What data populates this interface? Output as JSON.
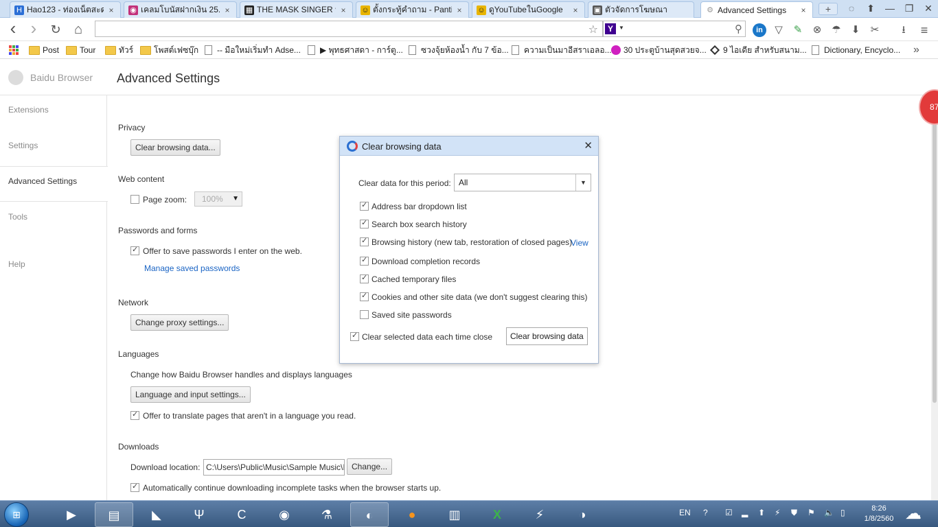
{
  "tabs": [
    {
      "title": "Hao123 - ท่องเน็ตสะด",
      "favicon_color": "#2c6fd6",
      "favicon_text": "H"
    },
    {
      "title": "เคลมโบนัสฝากเงิน 25.",
      "favicon_color": "#c2317a",
      "favicon_text": "◉"
    },
    {
      "title": "THE MASK SINGER ห",
      "favicon_color": "#222222",
      "favicon_text": "▦"
    },
    {
      "title": "ตั้งกระทู้คำถาม - Pantip",
      "favicon_color": "#e8b400",
      "favicon_text": "☺"
    },
    {
      "title": "ดูYouTubeในGoogle",
      "favicon_color": "#e8b400",
      "favicon_text": "☺"
    },
    {
      "title": "ตัวจัดการโฆษณา",
      "favicon_color": "#555555",
      "favicon_text": "▣"
    },
    {
      "title": "Advanced Settings",
      "favicon_color": "#bbbbbb",
      "favicon_text": "⚙"
    }
  ],
  "tab_close": "×",
  "window": {
    "minimize": "—",
    "maximize": "❐",
    "close": "✕",
    "newtab": "+"
  },
  "toolbar": {
    "back": "‹",
    "forward": "›",
    "reload": "↻",
    "home": "⌂",
    "url": "",
    "star": "☆",
    "search_engine": "Y",
    "search_caret": "▼",
    "search_icon": "⚲"
  },
  "toolbar_icons": [
    "in",
    "▽",
    "✎",
    "⊗",
    "☂",
    "⬇",
    "✂",
    "⭳",
    "≡"
  ],
  "bookmarks": [
    {
      "label": "",
      "type": "apps"
    },
    {
      "label": "Post",
      "type": "folder"
    },
    {
      "label": "Tour",
      "type": "folder"
    },
    {
      "label": "ทัวร์",
      "type": "folder"
    },
    {
      "label": "โพสต์เฟซบุ๊ก",
      "type": "folder"
    },
    {
      "label": "-- มือใหม่เริ่มทำ Adse...",
      "type": "page"
    },
    {
      "label": "▶ พุทธศาสดา - การ์ตู...",
      "type": "page"
    },
    {
      "label": "ซวงจุ้ยห้องน้ำ กับ 7 ข้อ...",
      "type": "page"
    },
    {
      "label": "ความเป็นมาอีสราเอลอ...",
      "type": "page"
    },
    {
      "label": "30 ประตูบ้านสุดสวยจ...",
      "type": "circle"
    },
    {
      "label": "9 ไอเดีย สำหรับสนาม...",
      "type": "diamond"
    },
    {
      "label": "Dictionary, Encyclo...",
      "type": "page"
    }
  ],
  "bookmarks_more": "»",
  "header": {
    "brand": "Baidu Browser",
    "page_title": "Advanced Settings"
  },
  "sidebar": {
    "items": [
      {
        "label": "Extensions"
      },
      {
        "label": "Settings"
      },
      {
        "label": "Advanced Settings",
        "active": true
      },
      {
        "label": "Tools"
      },
      {
        "label": "Help"
      }
    ]
  },
  "privacy": {
    "heading": "Privacy",
    "clear_button": "Clear browsing data..."
  },
  "web_content": {
    "heading": "Web content",
    "page_zoom_label": "Page zoom:",
    "page_zoom_value": "100%",
    "arrow": "▼"
  },
  "passwords": {
    "heading": "Passwords and forms",
    "offer_save": "Offer to save passwords I enter on the web.",
    "manage_link": "Manage saved passwords"
  },
  "network": {
    "heading": "Network",
    "proxy_button": "Change proxy settings..."
  },
  "languages": {
    "heading": "Languages",
    "description": "Change how Baidu Browser handles and displays languages",
    "lang_button": "Language and input settings...",
    "translate": "Offer to translate pages that aren't in a language you read."
  },
  "downloads": {
    "heading": "Downloads",
    "location_label": "Download location:",
    "location_value": "C:\\Users\\Public\\Music\\Sample Music\\I",
    "change_button": "Change...",
    "auto_continue": "Automatically continue downloading incomplete tasks when the browser starts up."
  },
  "badge": {
    "count": "87"
  },
  "dialog": {
    "title": "Clear browsing data",
    "close": "✕",
    "period_label": "Clear data for this period:",
    "period_value": "All",
    "period_arrow": "▼",
    "options": [
      {
        "label": "Address bar dropdown list",
        "checked": true
      },
      {
        "label": "Search box search history",
        "checked": true
      },
      {
        "label": "Browsing history (new tab, restoration of closed pages)",
        "checked": true,
        "link": "View"
      },
      {
        "label": "Download completion records",
        "checked": true
      },
      {
        "label": "Cached temporary files",
        "checked": true
      },
      {
        "label": "Cookies and other site data (we don't suggest clearing this)",
        "checked": true
      },
      {
        "label": "Saved site passwords",
        "checked": false
      }
    ],
    "each_close_label": "Clear selected data each time close",
    "clear_button": "Clear browsing data"
  },
  "taskbar": {
    "start": "⊞",
    "apps": [
      "▶",
      "▤",
      "◣",
      "Ψ",
      "C",
      "◉",
      "⚗",
      "◐",
      "●",
      "▥",
      "X",
      "⚡",
      "◑"
    ],
    "tray_lang": "EN",
    "tray_icons": [
      "?",
      "☑",
      "▂",
      "⬆",
      "⚡",
      "⛊",
      "⚑",
      "🔈",
      "▯"
    ],
    "time": "8:26",
    "date": "1/8/2560",
    "weather_icon": "☁"
  }
}
